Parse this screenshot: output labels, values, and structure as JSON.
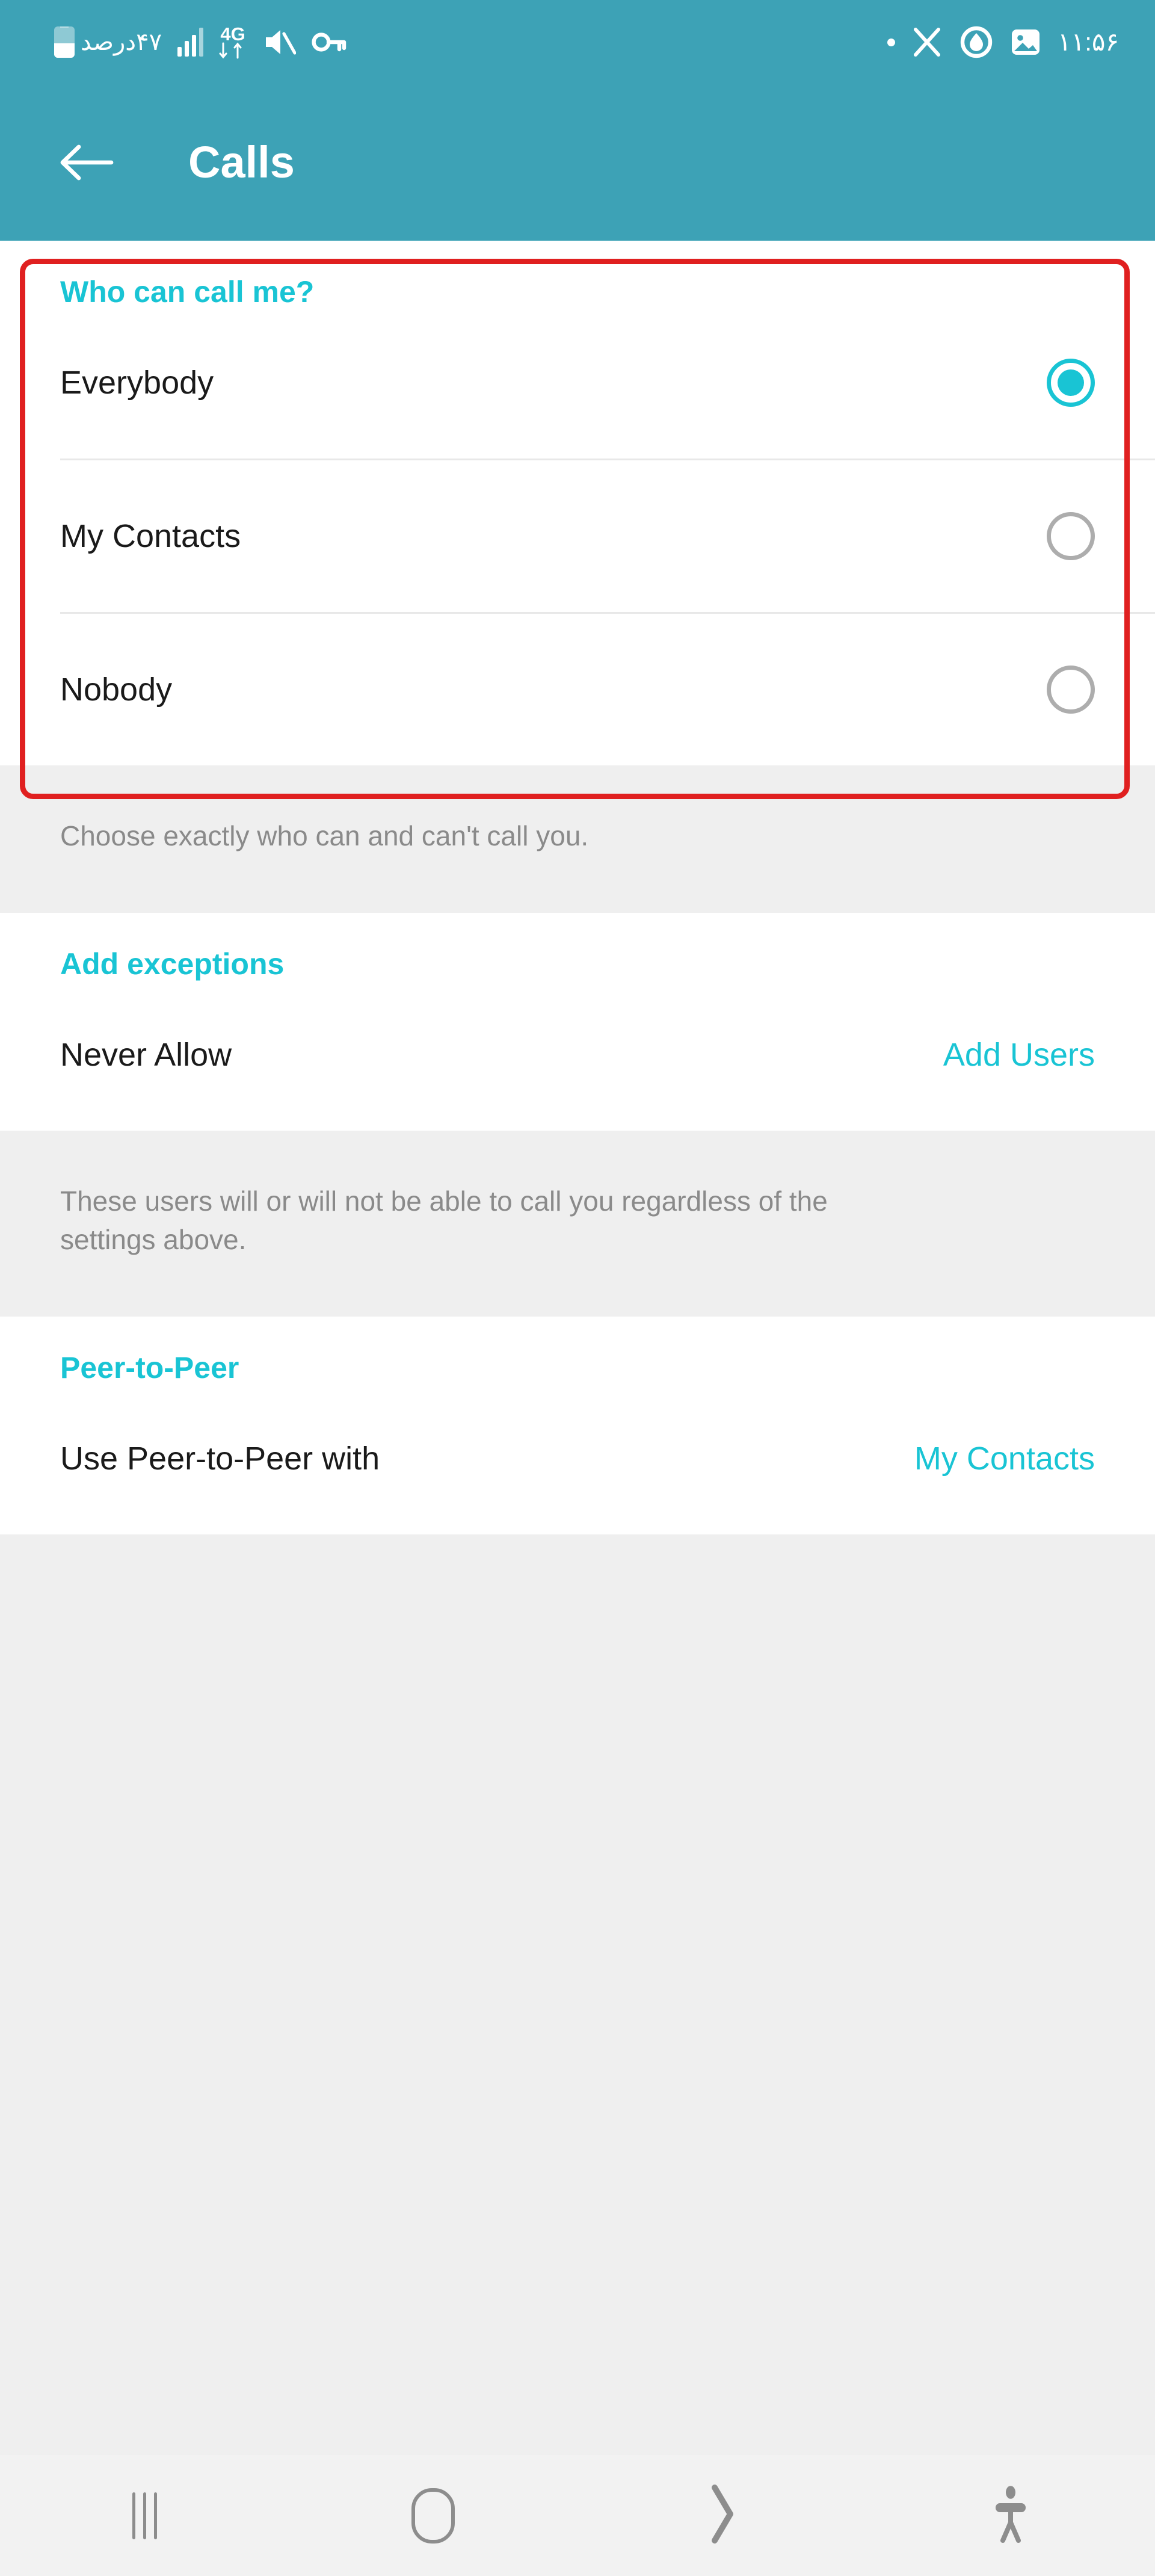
{
  "status_bar": {
    "battery_icon": "battery-icon",
    "battery_text": "۴۷درصد",
    "signal_icon": "signal-bars-icon",
    "network_label": "4G",
    "data_arrows_icon": "data-transfer-icon",
    "mute_icon": "volume-muted-icon",
    "vpn_key_icon": "vpn-key-icon",
    "dot_icon": "notification-dot-icon",
    "x_icon": "x-app-icon",
    "power_drop_icon": "power-drop-icon",
    "image_icon": "image-icon",
    "time": "۱۱:۵۶"
  },
  "app_bar": {
    "back_icon": "back-arrow-icon",
    "title": "Calls"
  },
  "who_can_call": {
    "section_title": "Who can call me?",
    "options": [
      {
        "label": "Everybody",
        "selected": true
      },
      {
        "label": "My Contacts",
        "selected": false
      },
      {
        "label": "Nobody",
        "selected": false
      }
    ],
    "footnote": "Choose exactly who can and can't call you."
  },
  "add_exceptions": {
    "section_title": "Add exceptions",
    "row_label": "Never Allow",
    "row_value": "Add Users",
    "footnote": "These users will or will not be able to call you regardless of the settings above."
  },
  "peer_to_peer": {
    "section_title": "Peer-to-Peer",
    "row_label": "Use Peer-to-Peer with",
    "row_value": "My Contacts"
  },
  "nav_bar": {
    "recents_icon": "recents-icon",
    "home_icon": "home-icon",
    "back_icon": "back-chevron-icon",
    "accessibility_icon": "accessibility-icon"
  },
  "colors": {
    "header": "#3DA2B6",
    "accent": "#19C4D4",
    "highlight": "#E02020",
    "section_bg": "#EFEFEF"
  }
}
